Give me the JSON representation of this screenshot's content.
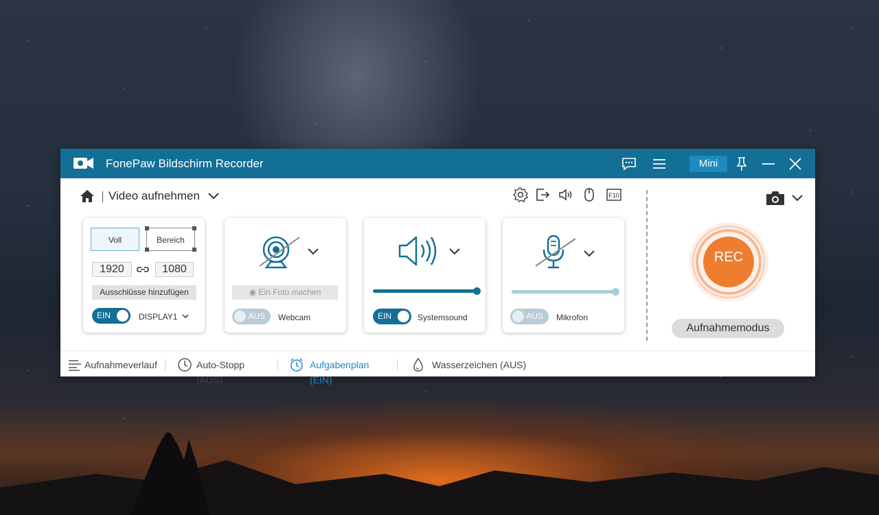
{
  "window": {
    "title": "FonePaw Bildschirm Recorder",
    "mini_label": "Mini",
    "accent": "#146f97"
  },
  "header": {
    "title": "Video aufnehmen",
    "icons": [
      "home-icon",
      "chevron-down-icon",
      "gear-icon",
      "export-icon",
      "speaker-icon",
      "mouse-icon",
      "f10-icon"
    ],
    "f10_label": "F10"
  },
  "screen_card": {
    "voll_label": "Voll",
    "bereich_label": "Bereich",
    "width": "1920",
    "height": "1080",
    "exclusions_label": "Ausschlüsse hinzufügen",
    "toggle_label": "EIN",
    "display_label": "DISPLAY1"
  },
  "webcam_card": {
    "photo_label": "Ein Foto machen",
    "toggle_label": "AUS",
    "label": "Webcam"
  },
  "systemsound_card": {
    "toggle_label": "EIN",
    "label": "Systemsound",
    "volume": 1.0
  },
  "mic_card": {
    "toggle_label": "AUS",
    "label": "Mikrofon",
    "volume": 1.0
  },
  "right_panel": {
    "rec_label": "REC",
    "mode_label": "Aufnahmemodus",
    "rec_color": "#ee7d30"
  },
  "bottom_bar": {
    "history": "Aufnahmeverlauf",
    "autostop": "Auto-Stopp (AUS)",
    "schedule": "Aufgabenplan (EIN)",
    "watermark": "Wasserzeichen (AUS)"
  }
}
